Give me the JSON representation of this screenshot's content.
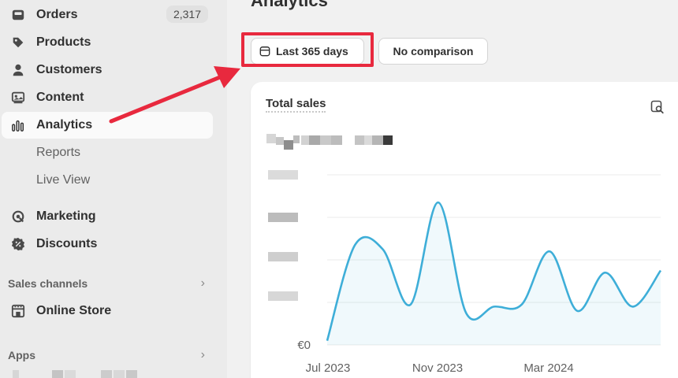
{
  "sidebar": {
    "items": [
      {
        "label": "Orders",
        "badge": "2,317",
        "icon": "inbox-icon"
      },
      {
        "label": "Products",
        "icon": "tag-icon"
      },
      {
        "label": "Customers",
        "icon": "person-icon"
      },
      {
        "label": "Content",
        "icon": "content-icon"
      },
      {
        "label": "Analytics",
        "icon": "bar-chart-icon",
        "active": true
      },
      {
        "label": "Marketing",
        "icon": "target-icon"
      },
      {
        "label": "Discounts",
        "icon": "discount-icon"
      },
      {
        "label": "Online Store",
        "icon": "store-icon"
      }
    ],
    "sub_items": [
      "Reports",
      "Live View"
    ],
    "sections": {
      "sales_channels": "Sales channels",
      "apps": "Apps"
    }
  },
  "main": {
    "page_title": "Analytics",
    "date_range_label": "Last 365 days",
    "comparison_label": "No comparison",
    "card_title": "Total sales"
  },
  "chart_data": {
    "type": "area",
    "x_tick_labels": [
      "Jul 2023",
      "Nov 2023",
      "Mar 2024"
    ],
    "y_tick_labels": [
      "€0"
    ],
    "series": [
      {
        "values": [
          0.1,
          2.35,
          2.25,
          0.95,
          3.35,
          0.75,
          0.9,
          0.95,
          2.2,
          0.8,
          1.7,
          0.9,
          1.75
        ]
      }
    ],
    "ylim": [
      0,
      4
    ],
    "grid": true,
    "legend": "none",
    "color": "#3eaed8"
  },
  "colors": {
    "annotation": "#e8293e",
    "line": "#3eaed8"
  }
}
